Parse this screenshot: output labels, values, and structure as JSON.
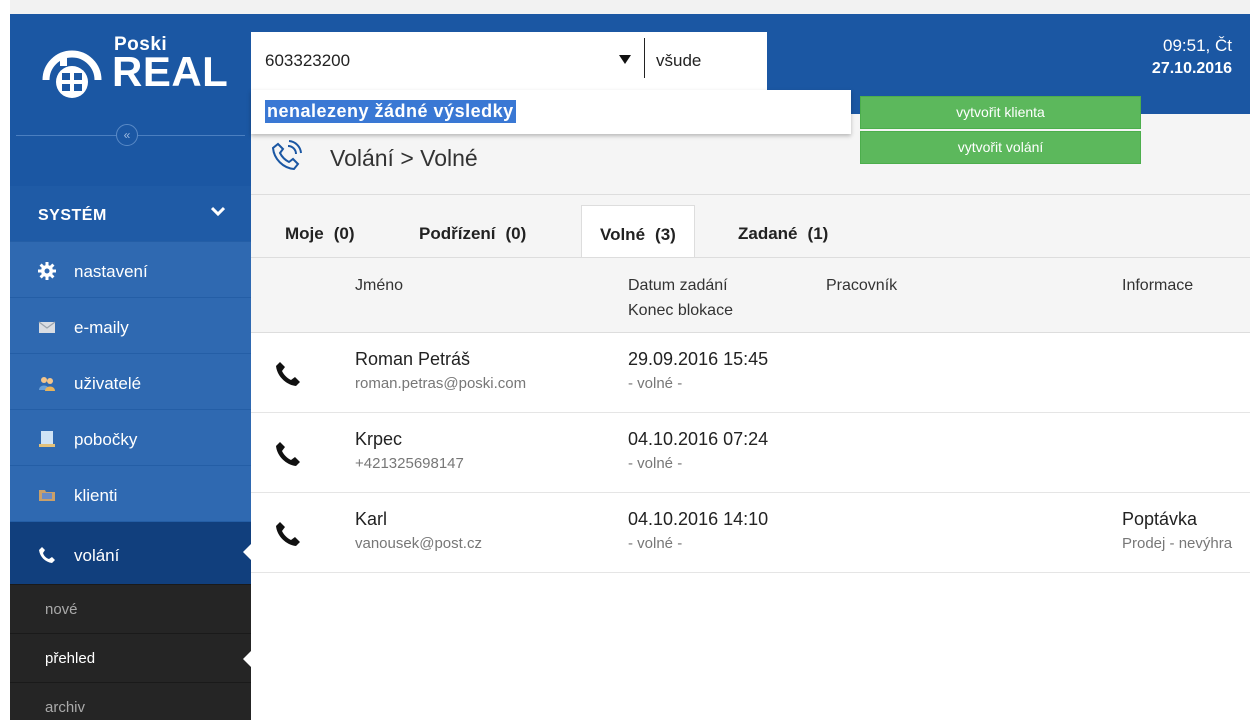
{
  "brand": {
    "line1": "Poski",
    "line2": "REAL"
  },
  "sidebar": {
    "collapse_label": "«",
    "section": "SYSTÉM",
    "items": [
      {
        "label": "nastavení",
        "icon": "gear-icon"
      },
      {
        "label": "e-maily",
        "icon": "envelope-icon"
      },
      {
        "label": "uživatelé",
        "icon": "users-icon"
      },
      {
        "label": "pobočky",
        "icon": "building-icon"
      },
      {
        "label": "klienti",
        "icon": "folder-icon"
      },
      {
        "label": "volání",
        "icon": "phone-icon"
      }
    ],
    "subitems": [
      {
        "label": "nové"
      },
      {
        "label": "přehled"
      },
      {
        "label": "archiv"
      }
    ]
  },
  "search": {
    "value": "603323200",
    "scope": "všude",
    "no_results": "nenalezeny žádné výsledky"
  },
  "actions": {
    "create_client": "vytvořit klienta",
    "create_call": "vytvořit volání"
  },
  "datetime": {
    "time": "09:51, Čt",
    "date": "27.10.2016"
  },
  "breadcrumb": "Volání > Volné",
  "tabs": [
    {
      "label": "Moje",
      "count": "(0)"
    },
    {
      "label": "Podřízení",
      "count": "(0)"
    },
    {
      "label": "Volné",
      "count": "(3)"
    },
    {
      "label": "Zadané",
      "count": "(1)"
    }
  ],
  "table": {
    "headers": {
      "name": "Jméno",
      "date": "Datum zadání",
      "date2": "Konec blokace",
      "worker": "Pracovník",
      "info": "Informace"
    },
    "rows": [
      {
        "name": "Roman Petráš",
        "contact": "roman.petras@poski.com",
        "date": "29.09.2016 15:45",
        "block": "- volné -",
        "info": "",
        "info_sub": ""
      },
      {
        "name": "Krpec",
        "contact": "+421325698147",
        "date": "04.10.2016 07:24",
        "block": "- volné -",
        "info": "",
        "info_sub": ""
      },
      {
        "name": "Karl",
        "contact": "vanousek@post.cz",
        "date": "04.10.2016 14:10",
        "block": "- volné -",
        "info": "Poptávka",
        "info_sub": "Prodej - nevýhra"
      }
    ]
  }
}
